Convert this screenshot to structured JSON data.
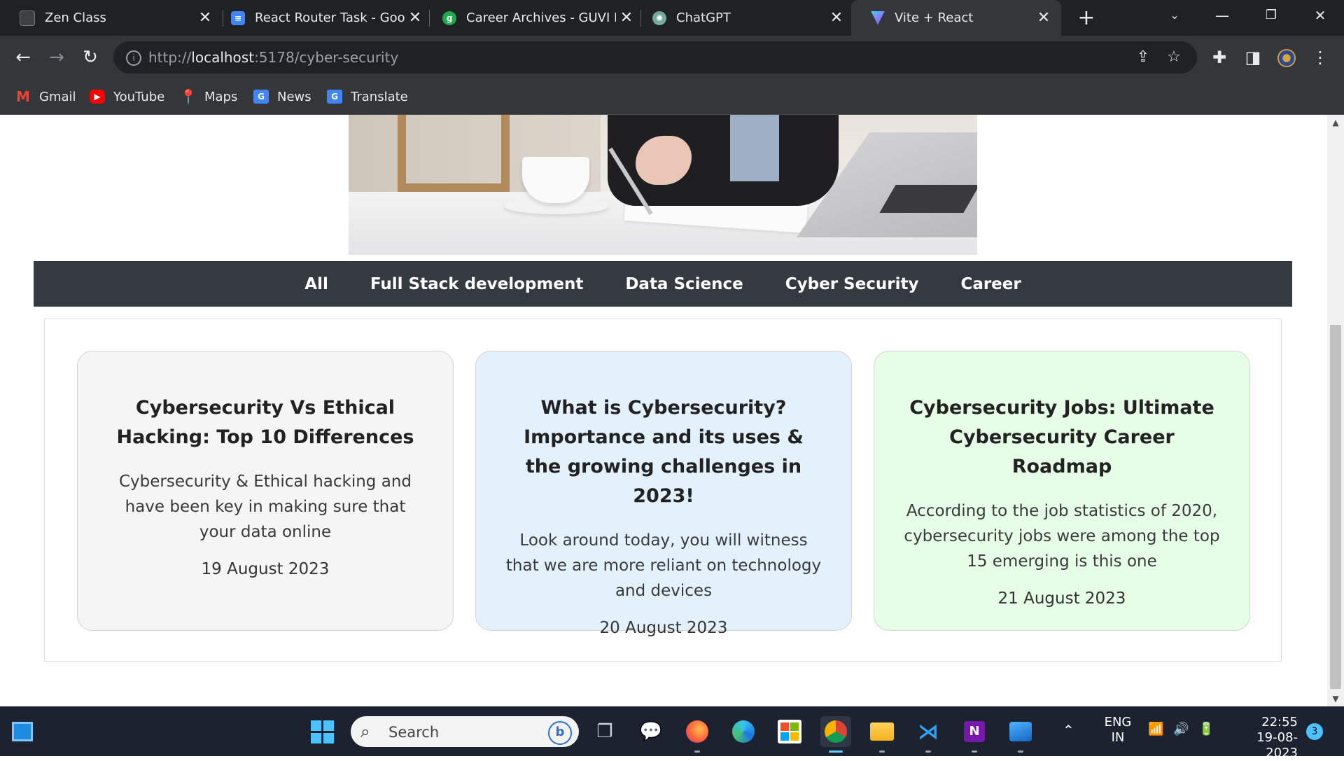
{
  "browser": {
    "tabs": [
      {
        "title": "Zen Class",
        "active": false
      },
      {
        "title": "React Router Task - Googl",
        "active": false
      },
      {
        "title": "Career Archives - GUVI Bl",
        "active": false
      },
      {
        "title": "ChatGPT",
        "active": false
      },
      {
        "title": "Vite + React",
        "active": true
      }
    ],
    "new_tab": "+",
    "url_scheme": "http://",
    "url_host": "localhost",
    "url_rest": ":5178/cyber-security",
    "bookmarks": [
      {
        "label": "Gmail"
      },
      {
        "label": "YouTube"
      },
      {
        "label": "Maps"
      },
      {
        "label": "News"
      },
      {
        "label": "Translate"
      }
    ]
  },
  "page": {
    "categories": [
      "All",
      "Full Stack development",
      "Data Science",
      "Cyber Security",
      "Career"
    ],
    "cards": [
      {
        "title": "Cybersecurity Vs Ethical Hacking: Top 10 Differences",
        "summary": "Cybersecurity & Ethical hacking and have been key in making sure that your data online",
        "date": "19 August 2023",
        "background": "#f5f5f5"
      },
      {
        "title": "What is Cybersecurity? Importance and its uses & the growing challenges in 2023!",
        "summary": "Look around today, you will witness that we are more reliant on technology and devices",
        "date": "20 August 2023",
        "background": "#e3f1fd"
      },
      {
        "title": "Cybersecurity Jobs: Ultimate Cybersecurity Career Roadmap",
        "summary": "According to the job statistics of 2020, cybersecurity jobs were among the top 15 emerging is this one",
        "date": "21 August 2023",
        "background": "#e6fde6"
      }
    ],
    "nav_background": "#343a40"
  },
  "taskbar": {
    "search_placeholder": "Search",
    "language": "ENG",
    "region": "IN",
    "time": "22:55",
    "date": "19-08-2023",
    "notification_count": "3"
  }
}
